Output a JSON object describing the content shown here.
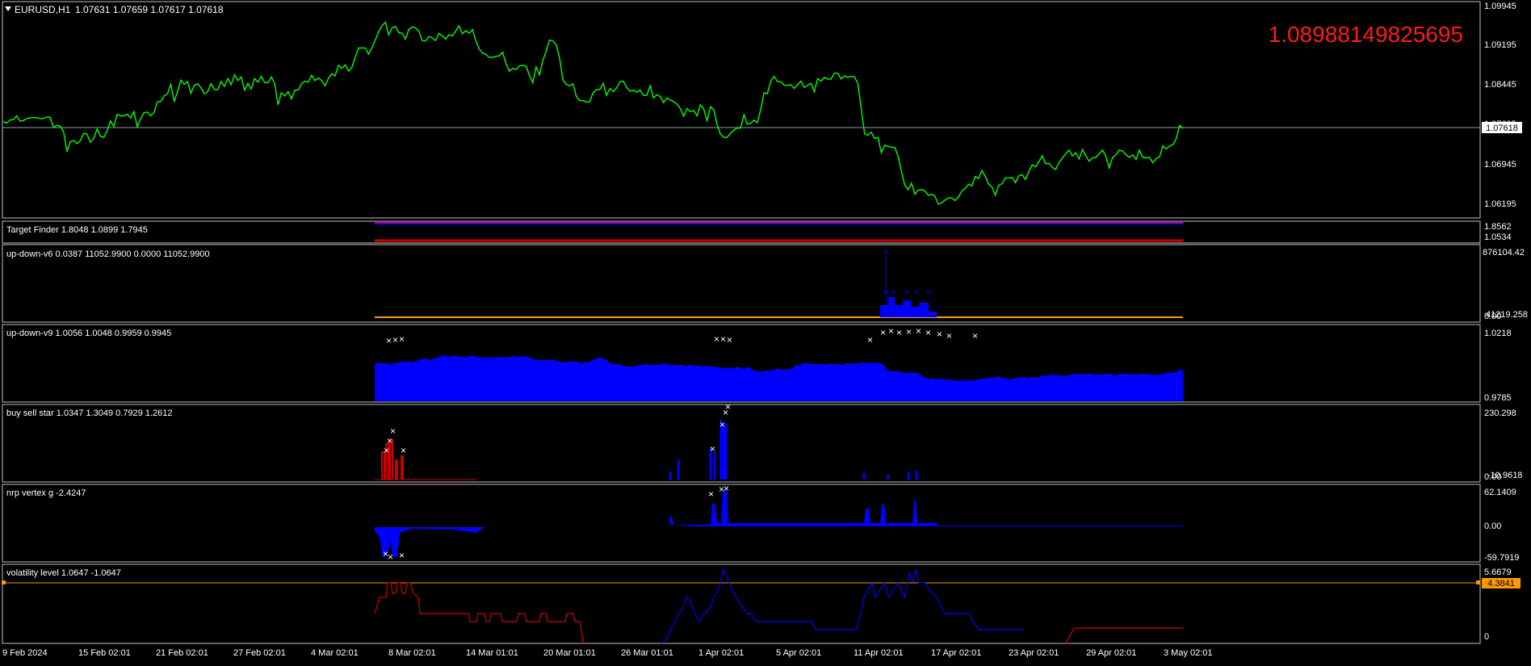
{
  "window": {
    "title": "EURUSD,H1"
  },
  "colors": {
    "background": "#000000",
    "frame": "#c0c0c0",
    "price_line": "#00ff00",
    "bid_line": "#8aa0a8",
    "big_value": "#ff1a1a",
    "blue_series": "#0000ff",
    "red_series": "#cc0000",
    "magenta_series": "#aa00aa",
    "orange_series": "#ff9900",
    "marker": "#ffffff",
    "level_line": "#ff9900",
    "level_badge": "#ff9900"
  },
  "main": {
    "ohlc": "1.07631 1.07659 1.07617 1.07618",
    "big_value": "1.08988149825695",
    "current_price": "1.07618",
    "price_ticks": [
      "1.09945",
      "1.09195",
      "1.08445",
      "1.07695",
      "1.06945",
      "1.06195"
    ]
  },
  "panes": [
    {
      "label": "Target Finder 1.8048 1.0899 1.7945",
      "scale": [
        "1.8562",
        "1.0534"
      ]
    },
    {
      "label": "up-down-v6 0.0387 11052.9900 0.0000 11052.9900",
      "scale": [
        "876104.42",
        "41219.258",
        "0.00"
      ]
    },
    {
      "label": "up-down-v9 1.0056 1.0048 0.9959 0.9945",
      "scale": [
        "1.0218",
        "0.9785"
      ]
    },
    {
      "label": "buy sell star 1.0347 1.3049 0.7929 1.2612",
      "scale": [
        "230.298",
        "-10.9618",
        "0.00"
      ]
    },
    {
      "label": "nrp vertex g -2.4247",
      "scale": [
        "62.1409",
        "0.00",
        "-59.7919"
      ]
    },
    {
      "label": "volatility level 1.0647 -1.0647",
      "scale": [
        "5.6679",
        "0"
      ],
      "level_badge": "4.3841"
    }
  ],
  "time_axis": [
    "9 Feb 2024",
    "15 Feb 02:01",
    "21 Feb 02:01",
    "27 Feb 02:01",
    "4 Mar 02:01",
    "8 Mar 02:01",
    "14 Mar 01:01",
    "20 Mar 01:01",
    "26 Mar 01:01",
    "1 Apr 02:01",
    "5 Apr 02:01",
    "11 Apr 02:01",
    "17 Apr 02:01",
    "23 Apr 02:01",
    "29 Apr 02:01",
    "3 May 02:01"
  ],
  "chart_data": {
    "type": "line",
    "price_series": [
      1.0775,
      1.0772,
      1.0778,
      1.0779,
      1.0786,
      1.0776,
      1.0777,
      1.0781,
      1.0782,
      1.0783,
      1.0782,
      1.0781,
      1.0781,
      1.0784,
      1.0783,
      1.0764,
      1.0768,
      1.0766,
      1.0756,
      1.0718,
      1.0737,
      1.0739,
      1.0733,
      1.0739,
      1.0753,
      1.0751,
      1.0736,
      1.0743,
      1.0761,
      1.0747,
      1.0745,
      1.0758,
      1.0776,
      1.0766,
      1.0789,
      1.0786,
      1.0786,
      1.0789,
      1.0782,
      1.0794,
      1.0765,
      1.0781,
      1.0792,
      1.0793,
      1.0786,
      1.0793,
      1.0813,
      1.0813,
      1.0824,
      1.0828,
      1.0846,
      1.0814,
      1.0832,
      1.0854,
      1.0846,
      1.0851,
      1.0829,
      1.0844,
      1.0847,
      1.0839,
      1.0828,
      1.0832,
      1.0847,
      1.0836,
      1.0836,
      1.0851,
      1.0842,
      1.0857,
      1.0845,
      1.0864,
      1.0853,
      1.086,
      1.0835,
      1.0848,
      1.0837,
      1.0857,
      1.085,
      1.0861,
      1.0849,
      1.0849,
      1.086,
      1.0847,
      1.0807,
      1.083,
      1.0824,
      1.0832,
      1.0818,
      1.0835,
      1.0835,
      1.0847,
      1.0852,
      1.085,
      1.0863,
      1.0853,
      1.0858,
      1.0853,
      1.0843,
      1.0857,
      1.0866,
      1.0862,
      1.0882,
      1.0876,
      1.0883,
      1.0871,
      1.0878,
      1.0897,
      1.0915,
      1.0915,
      1.0915,
      1.0903,
      1.0916,
      1.093,
      1.0946,
      1.0957,
      1.0964,
      1.094,
      1.0953,
      1.0956,
      1.0944,
      1.0943,
      1.0932,
      1.095,
      1.0955,
      1.0953,
      1.0947,
      1.0929,
      1.0928,
      1.0937,
      1.0934,
      1.0929,
      1.0943,
      1.0938,
      1.0932,
      1.094,
      1.0938,
      1.0947,
      1.0957,
      1.0942,
      1.0948,
      1.0943,
      1.095,
      1.0929,
      1.0913,
      1.0905,
      1.0903,
      1.0897,
      1.0897,
      1.0899,
      1.09,
      1.0907,
      1.0885,
      1.0871,
      1.0876,
      1.0874,
      1.0881,
      1.0882,
      1.088,
      1.0863,
      1.0849,
      1.0879,
      1.0864,
      1.0891,
      1.0909,
      1.093,
      1.0928,
      1.0921,
      1.0895,
      1.0854,
      1.0846,
      1.0843,
      1.0847,
      1.0823,
      1.0815,
      1.0815,
      1.0812,
      1.0813,
      1.083,
      1.0836,
      1.0836,
      1.0848,
      1.0825,
      1.0838,
      1.0832,
      1.0839,
      1.0851,
      1.0852,
      1.084,
      1.0833,
      1.0835,
      1.0831,
      1.0835,
      1.0825,
      1.0825,
      1.0843,
      1.082,
      1.0826,
      1.0823,
      1.0811,
      1.082,
      1.0816,
      1.0813,
      1.0808,
      1.08,
      1.0785,
      1.08,
      1.0794,
      1.0796,
      1.0786,
      1.0807,
      1.0799,
      1.0777,
      1.0803,
      1.0798,
      1.0769,
      1.0751,
      1.0745,
      1.0745,
      1.0753,
      1.0759,
      1.0763,
      1.0763,
      1.0788,
      1.077,
      1.0772,
      1.0778,
      1.0773,
      1.0798,
      1.083,
      1.0828,
      1.0852,
      1.0861,
      1.0851,
      1.0851,
      1.0844,
      1.0844,
      1.0845,
      1.0838,
      1.0845,
      1.0852,
      1.084,
      1.0844,
      1.0848,
      1.0832,
      1.0857,
      1.0852,
      1.0859,
      1.0856,
      1.0856,
      1.0867,
      1.0867,
      1.0856,
      1.0862,
      1.0859,
      1.0861,
      1.086,
      1.0847,
      1.08,
      1.0752,
      1.0749,
      1.0755,
      1.0743,
      1.0745,
      1.0716,
      1.073,
      1.0728,
      1.0726,
      1.0726,
      1.0709,
      1.068,
      1.0654,
      1.0646,
      1.0658,
      1.0637,
      1.0645,
      1.0646,
      1.0643,
      1.0635,
      1.0637,
      1.0633,
      1.0618,
      1.0621,
      1.0626,
      1.063,
      1.063,
      1.0625,
      1.0632,
      1.0643,
      1.0648,
      1.0656,
      1.0653,
      1.0671,
      1.0667,
      1.0682,
      1.0671,
      1.0656,
      1.0651,
      1.0635,
      1.0654,
      1.0657,
      1.0668,
      1.0668,
      1.0669,
      1.0659,
      1.0672,
      1.0674,
      1.0665,
      1.068,
      1.0693,
      1.0689,
      1.0699,
      1.071,
      1.0695,
      1.0696,
      1.0688,
      1.0684,
      1.0697,
      1.0706,
      1.0714,
      1.0721,
      1.071,
      1.0716,
      1.0704,
      1.0722,
      1.071,
      1.07,
      1.0706,
      1.0707,
      1.0714,
      1.0721,
      1.0709,
      1.0687,
      1.0707,
      1.0712,
      1.0721,
      1.0719,
      1.0712,
      1.0707,
      1.0712,
      1.0703,
      1.0721,
      1.0707,
      1.0706,
      1.0707,
      1.0697,
      1.0705,
      1.0708,
      1.0729,
      1.0723,
      1.0729,
      1.0731,
      1.0743,
      1.0768,
      1.0762
    ],
    "price_range": [
      1.0595,
      1.1
    ],
    "volatility_level": [
      4.3841,
      0
    ]
  }
}
